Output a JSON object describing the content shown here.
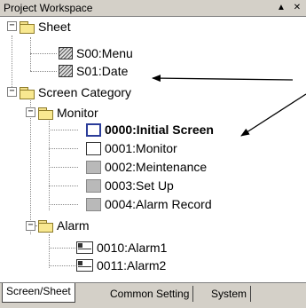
{
  "window": {
    "title": "Project Workspace",
    "pin_glyph": "▲",
    "close_glyph": "✕"
  },
  "tree": {
    "sheet": {
      "label": "Sheet",
      "items": [
        {
          "label": "S00:Menu",
          "icon": "hatched-sheet-icon"
        },
        {
          "label": "S01:Date",
          "icon": "hatched-sheet-icon"
        }
      ]
    },
    "screen_category": {
      "label": "Screen Category",
      "monitor": {
        "label": "Monitor",
        "items": [
          {
            "label": "0000:Initial Screen",
            "icon": "initial-screen-icon",
            "bold": true
          },
          {
            "label": "0001:Monitor",
            "icon": "screen-icon"
          },
          {
            "label": "0002:Meintenance",
            "icon": "grey-screen-icon"
          },
          {
            "label": "0003:Set Up",
            "icon": "grey-screen-icon"
          },
          {
            "label": "0004:Alarm Record",
            "icon": "grey-screen-icon"
          }
        ]
      },
      "alarm": {
        "label": "Alarm",
        "items": [
          {
            "label": "0010:Alarm1",
            "icon": "window-screen-icon"
          },
          {
            "label": "0011:Alarm2",
            "icon": "window-screen-icon"
          }
        ]
      }
    },
    "expand_glyph": "−"
  },
  "tabs": [
    {
      "label": "Screen/Sheet",
      "active": true
    },
    {
      "label": "Common Setting",
      "active": false
    },
    {
      "label": "System",
      "active": false
    }
  ]
}
